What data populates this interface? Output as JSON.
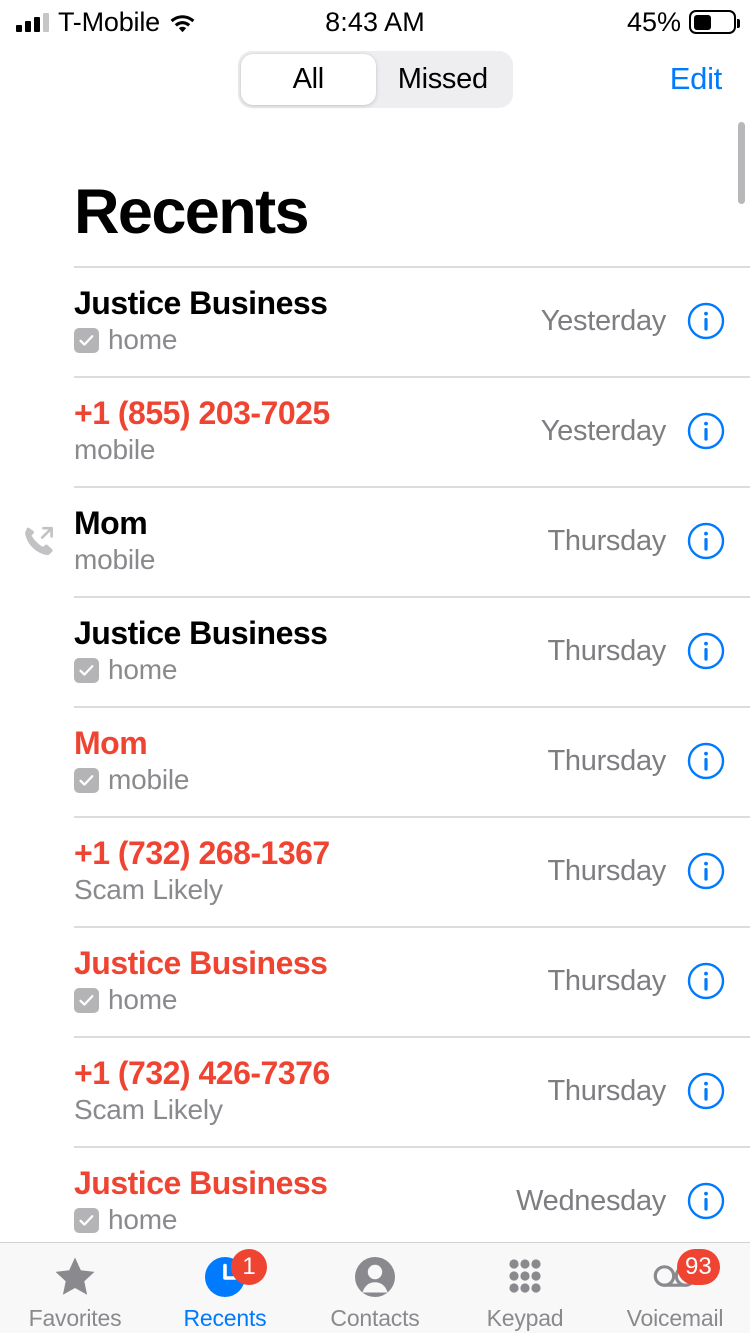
{
  "status_bar": {
    "carrier": "T-Mobile",
    "time": "8:43 AM",
    "battery_percent": "45%",
    "signal_icon": "signal-bars-icon",
    "wifi_icon": "wifi-icon",
    "battery_icon": "battery-icon",
    "battery_level": 45
  },
  "nav": {
    "segments": [
      {
        "label": "All",
        "selected": true
      },
      {
        "label": "Missed",
        "selected": false
      }
    ],
    "edit_label": "Edit"
  },
  "page": {
    "title": "Recents"
  },
  "calls": [
    {
      "name": "Justice Business",
      "missed": false,
      "label": "home",
      "has_checkbox": true,
      "time": "Yesterday",
      "direction_icon": null,
      "info_icon": "info-icon"
    },
    {
      "name": "+1 (855) 203-7025",
      "missed": true,
      "label": "mobile",
      "has_checkbox": false,
      "time": "Yesterday",
      "direction_icon": null,
      "info_icon": "info-icon"
    },
    {
      "name": "Mom",
      "missed": false,
      "label": "mobile",
      "has_checkbox": false,
      "time": "Thursday",
      "direction_icon": "outgoing-call-icon",
      "info_icon": "info-icon"
    },
    {
      "name": "Justice Business",
      "missed": false,
      "label": "home",
      "has_checkbox": true,
      "time": "Thursday",
      "direction_icon": null,
      "info_icon": "info-icon"
    },
    {
      "name": "Mom",
      "missed": true,
      "label": "mobile",
      "has_checkbox": true,
      "time": "Thursday",
      "direction_icon": null,
      "info_icon": "info-icon"
    },
    {
      "name": "+1 (732) 268-1367",
      "missed": true,
      "label": "Scam Likely",
      "has_checkbox": false,
      "time": "Thursday",
      "direction_icon": null,
      "info_icon": "info-icon"
    },
    {
      "name": "Justice Business",
      "missed": true,
      "label": "home",
      "has_checkbox": true,
      "time": "Thursday",
      "direction_icon": null,
      "info_icon": "info-icon"
    },
    {
      "name": "+1 (732) 426-7376",
      "missed": true,
      "label": "Scam Likely",
      "has_checkbox": false,
      "time": "Thursday",
      "direction_icon": null,
      "info_icon": "info-icon"
    },
    {
      "name": "Justice Business",
      "missed": true,
      "label": "home",
      "has_checkbox": true,
      "time": "Wednesday",
      "direction_icon": null,
      "info_icon": "info-icon"
    }
  ],
  "tab_bar": [
    {
      "label": "Favorites",
      "icon": "star-icon",
      "active": false,
      "badge": null
    },
    {
      "label": "Recents",
      "icon": "clock-icon",
      "active": true,
      "badge": "1"
    },
    {
      "label": "Contacts",
      "icon": "person-icon",
      "active": false,
      "badge": null
    },
    {
      "label": "Keypad",
      "icon": "keypad-icon",
      "active": false,
      "badge": null
    },
    {
      "label": "Voicemail",
      "icon": "voicemail-icon",
      "active": false,
      "badge": "93"
    }
  ],
  "colors": {
    "missed_red": "#ef4432",
    "accent_blue": "#007aff",
    "badge_red": "#ef4432",
    "secondary_gray": "#8a8a8e"
  }
}
